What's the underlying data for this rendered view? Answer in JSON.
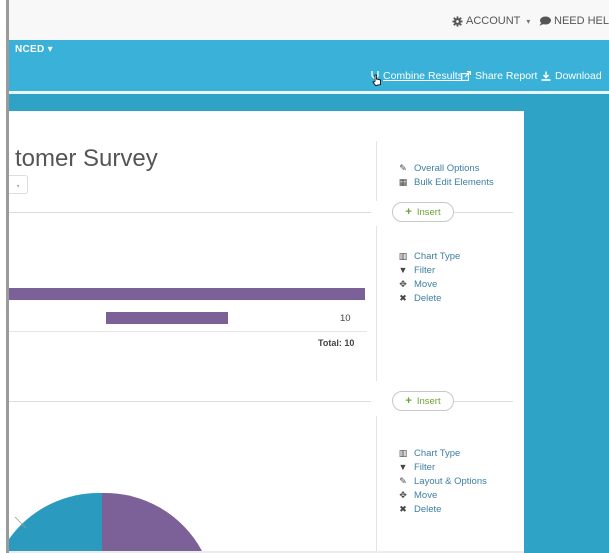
{
  "topbar": {
    "account_label": "ACCOUNT",
    "help_label": "NEED HELP?"
  },
  "nav": {
    "menu_label": "NCED",
    "combine_label": "Combine Results",
    "share_label": "Share Report",
    "download_label": "Download"
  },
  "report": {
    "title": "tomer Survey",
    "select_value": ","
  },
  "report_options": [
    {
      "icon": "pencil-icon",
      "label": "Overall Options"
    },
    {
      "icon": "table-icon",
      "label": "Bulk Edit Elements"
    }
  ],
  "insert_label": "Insert",
  "bar_chart": {
    "actions": [
      {
        "icon": "chart-icon",
        "label": "Chart Type"
      },
      {
        "icon": "filter-icon",
        "label": "Filter"
      },
      {
        "icon": "move-icon",
        "label": "Move"
      },
      {
        "icon": "delete-icon",
        "label": "Delete"
      }
    ],
    "visible_value": "10",
    "total_label": "Total: 10"
  },
  "pie_chart": {
    "actions": [
      {
        "icon": "chart-icon",
        "label": "Chart Type"
      },
      {
        "icon": "filter-icon",
        "label": "Filter"
      },
      {
        "icon": "pencil-icon",
        "label": "Layout & Options"
      },
      {
        "icon": "move-icon",
        "label": "Move"
      },
      {
        "icon": "delete-icon",
        "label": "Delete"
      }
    ]
  },
  "colors": {
    "nav_blue": "#3ab1d8",
    "band_blue": "#2ea3c6",
    "bar_purple": "#7b6198",
    "pie_teal": "#2a9bbf",
    "link_blue": "#3d7fa3",
    "insert_green": "#6da236"
  }
}
